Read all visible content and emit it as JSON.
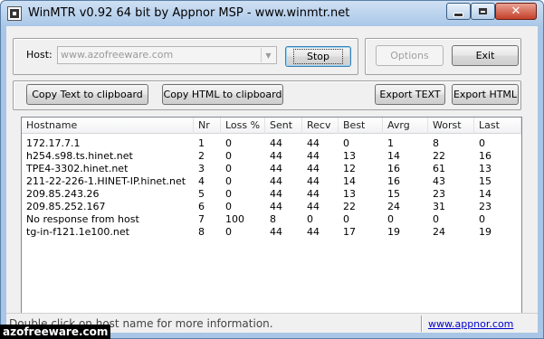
{
  "window": {
    "title": "WinMTR v0.92 64 bit by Appnor MSP - www.winmtr.net"
  },
  "controls": {
    "host_label": "Host:",
    "host_value": "www.azofreeware.com",
    "stop_label": "Stop",
    "options_label": "Options",
    "exit_label": "Exit",
    "copy_text_label": "Copy Text to clipboard",
    "copy_html_label": "Copy HTML to clipboard",
    "export_text_label": "Export TEXT",
    "export_html_label": "Export HTML"
  },
  "table": {
    "columns": [
      "Hostname",
      "Nr",
      "Loss %",
      "Sent",
      "Recv",
      "Best",
      "Avrg",
      "Worst",
      "Last"
    ],
    "rows": [
      [
        "172.17.7.1",
        "1",
        "0",
        "44",
        "44",
        "0",
        "1",
        "8",
        "0"
      ],
      [
        "h254.s98.ts.hinet.net",
        "2",
        "0",
        "44",
        "44",
        "13",
        "14",
        "22",
        "16"
      ],
      [
        "TPE4-3302.hinet.net",
        "3",
        "0",
        "44",
        "44",
        "12",
        "16",
        "61",
        "13"
      ],
      [
        "211-22-226-1.HINET-IP.hinet.net",
        "4",
        "0",
        "44",
        "44",
        "14",
        "16",
        "43",
        "15"
      ],
      [
        "209.85.243.26",
        "5",
        "0",
        "44",
        "44",
        "13",
        "15",
        "23",
        "14"
      ],
      [
        "209.85.252.167",
        "6",
        "0",
        "44",
        "44",
        "22",
        "24",
        "31",
        "23"
      ],
      [
        "No response from host",
        "7",
        "100",
        "8",
        "0",
        "0",
        "0",
        "0",
        "0"
      ],
      [
        "tg-in-f121.1e100.net",
        "8",
        "0",
        "44",
        "44",
        "17",
        "19",
        "24",
        "19"
      ]
    ]
  },
  "status": {
    "message": "Double click on host name for more information.",
    "link": "www.appnor.com"
  },
  "watermark": "azofreeware.com"
}
